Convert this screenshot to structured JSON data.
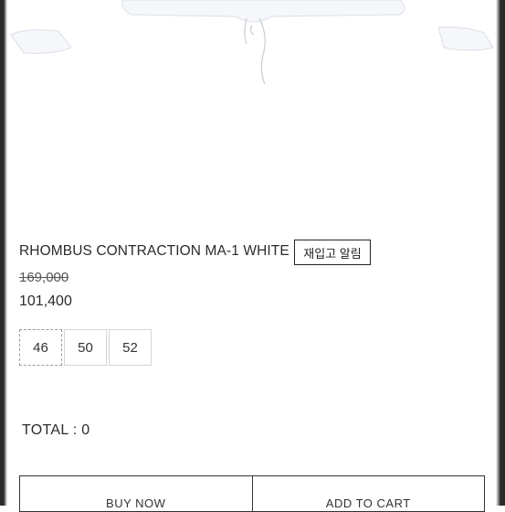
{
  "product": {
    "name": "RHOMBUS CONTRACTION MA-1 WHITE",
    "restock_label": "재입고 알림",
    "original_price": "169,000",
    "sale_price": "101,400"
  },
  "sizes": {
    "options": [
      "46",
      "50",
      "52"
    ],
    "selected": "46"
  },
  "total": {
    "label": "TOTAL : 0"
  },
  "buttons": {
    "buy_now": "BUY NOW",
    "add_to_cart": "ADD TO CART"
  },
  "colors": {
    "garment": "#f4f6fa",
    "text": "#222222"
  }
}
